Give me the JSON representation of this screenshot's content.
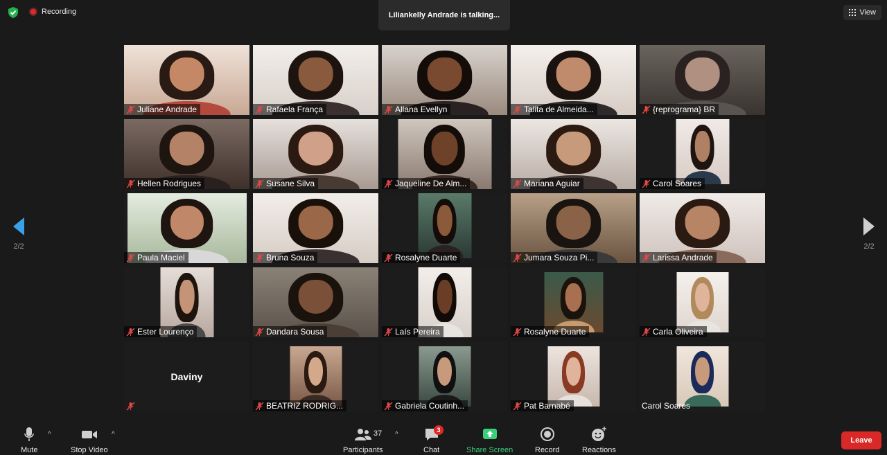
{
  "header": {
    "recording_label": "Recording",
    "talking_banner": "Liliankelly Andrade is talking...",
    "view_label": "View",
    "security_icon": "shield-check-icon",
    "recording_icon": "record-dot-icon",
    "view_icon": "grid-icon"
  },
  "pager": {
    "left_page": "2/2",
    "right_page": "2/2",
    "prev_icon": "arrow-left-icon",
    "next_icon": "arrow-right-icon"
  },
  "participants": [
    {
      "name": "Juliane Andrade"
    },
    {
      "name": "Rafaela França"
    },
    {
      "name": "Allana Evellyn"
    },
    {
      "name": "Talita de Almeida..."
    },
    {
      "name": "{reprograma} BR"
    },
    {
      "name": "Hellen Rodrigues"
    },
    {
      "name": "Susane Silva"
    },
    {
      "name": "Jaqueline De Alm..."
    },
    {
      "name": "Mariana Aguiar"
    },
    {
      "name": "Carol Soares"
    },
    {
      "name": "Paula Maciel"
    },
    {
      "name": "Bruna Souza"
    },
    {
      "name": "Rosalyne Duarte"
    },
    {
      "name": "Jumara Souza Pi..."
    },
    {
      "name": "Larissa Andrade"
    },
    {
      "name": "Ester Lourenço"
    },
    {
      "name": "Dandara Sousa"
    },
    {
      "name": "Laís Pereira"
    },
    {
      "name": "Rosalyne Duarte"
    },
    {
      "name": "Carla Oliveira"
    },
    {
      "name": "Daviny"
    },
    {
      "name": "BEATRIZ RODRIG..."
    },
    {
      "name": "Gabriela Coutinh..."
    },
    {
      "name": "Pat Barnabé"
    },
    {
      "name": "Carol Soares"
    }
  ],
  "toolbar": {
    "mute": "Mute",
    "stop_video": "Stop Video",
    "participants": "Participants",
    "participant_count": "37",
    "chat": "Chat",
    "chat_badge": "3",
    "share_screen": "Share Screen",
    "record": "Record",
    "reactions": "Reactions",
    "leave": "Leave",
    "icons": [
      "microphone-icon",
      "video-camera-icon",
      "participants-icon",
      "chat-icon",
      "share-screen-icon",
      "record-icon",
      "reactions-icon"
    ]
  },
  "colors": {
    "leave": "#d92828",
    "share": "#3ad07a",
    "badge": "#e02828",
    "background": "#1a1a1a"
  }
}
